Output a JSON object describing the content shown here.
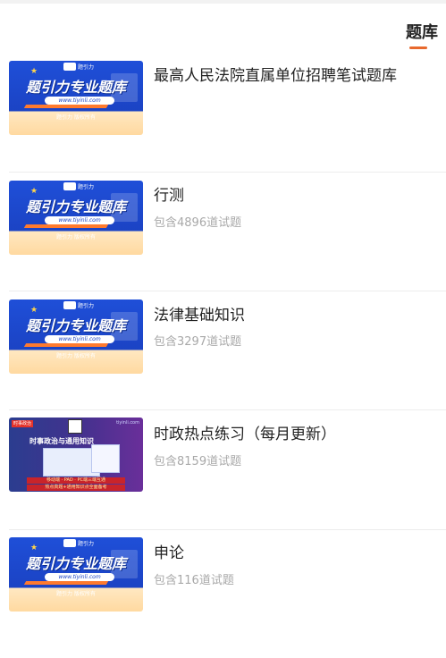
{
  "header": {
    "tab_label": "题库"
  },
  "thumbs": {
    "banner_big": "题引力专业题库",
    "banner_url": "www.tiyinli.com",
    "banner_copy": "题引力 版权所有",
    "banner_logo_text": "题引力",
    "news_tag": "时事政治",
    "news_site": "tiyinli.com",
    "news_head": "时事政治与通用知识",
    "news_bar1": "移动端 · PAD · PC端三端互通",
    "news_bar2": "热点真题+通用知识点全面备考"
  },
  "items": [
    {
      "title": "最高人民法院直属单位招聘笔试题库",
      "sub": "",
      "thumb": "banner"
    },
    {
      "title": "行测",
      "sub": "包含4896道试题",
      "thumb": "banner"
    },
    {
      "title": "法律基础知识",
      "sub": "包含3297道试题",
      "thumb": "banner"
    },
    {
      "title": "时政热点练习（每月更新）",
      "sub": "包含8159道试题",
      "thumb": "news"
    },
    {
      "title": "申论",
      "sub": "包含116道试题",
      "thumb": "banner"
    }
  ],
  "colors": {
    "accent": "#e8692d",
    "title": "#222222",
    "subtitle": "#a9a9a9",
    "banner_blue": "#1f4fd8"
  }
}
